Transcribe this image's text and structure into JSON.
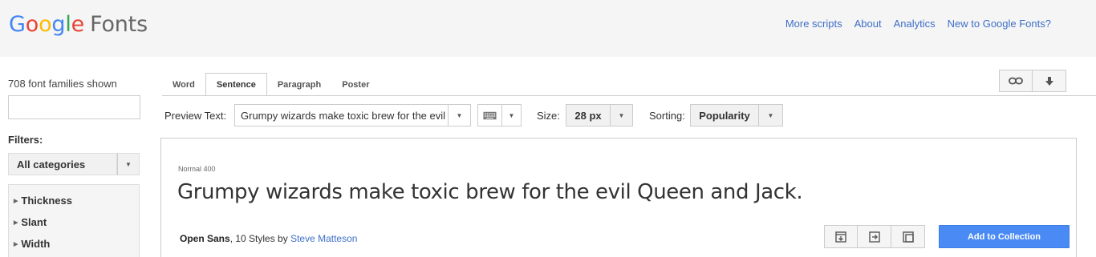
{
  "header": {
    "logo_letters": [
      {
        "ch": "G",
        "color": "#4285F4"
      },
      {
        "ch": "o",
        "color": "#EA4335"
      },
      {
        "ch": "o",
        "color": "#FBBC05"
      },
      {
        "ch": "g",
        "color": "#4285F4"
      },
      {
        "ch": "l",
        "color": "#34A853"
      },
      {
        "ch": "e",
        "color": "#EA4335"
      }
    ],
    "logo_suffix": "Fonts",
    "nav": [
      "More scripts",
      "About",
      "Analytics",
      "New to Google Fonts?"
    ]
  },
  "sidebar": {
    "count_text": "708 font families shown",
    "search_value": "",
    "filters_label": "Filters:",
    "category": "All categories",
    "filters": [
      "Thickness",
      "Slant",
      "Width"
    ]
  },
  "tabs": {
    "items": [
      "Word",
      "Sentence",
      "Paragraph",
      "Poster"
    ],
    "active": "Sentence"
  },
  "toolbar_icons": [
    "link-icon",
    "download-arrow-icon"
  ],
  "controls": {
    "preview_label": "Preview Text:",
    "preview_value": "Grumpy wizards make toxic brew for the evil",
    "keyboard_icon": "keyboard-icon",
    "size_label": "Size:",
    "size_value": "28 px",
    "sorting_label": "Sorting:",
    "sorting_value": "Popularity"
  },
  "font_card": {
    "style_label": "Normal 400",
    "sample_text": "Grumpy wizards make toxic brew for the evil Queen and Jack.",
    "family_name": "Open Sans",
    "styles_text": ", 10 Styles by ",
    "author": "Steve Matteson",
    "action_icons": [
      "quick-use-icon",
      "open-in-page-icon",
      "pop-out-icon"
    ],
    "add_button": "Add to Collection",
    "accent": "#4a8af4"
  }
}
